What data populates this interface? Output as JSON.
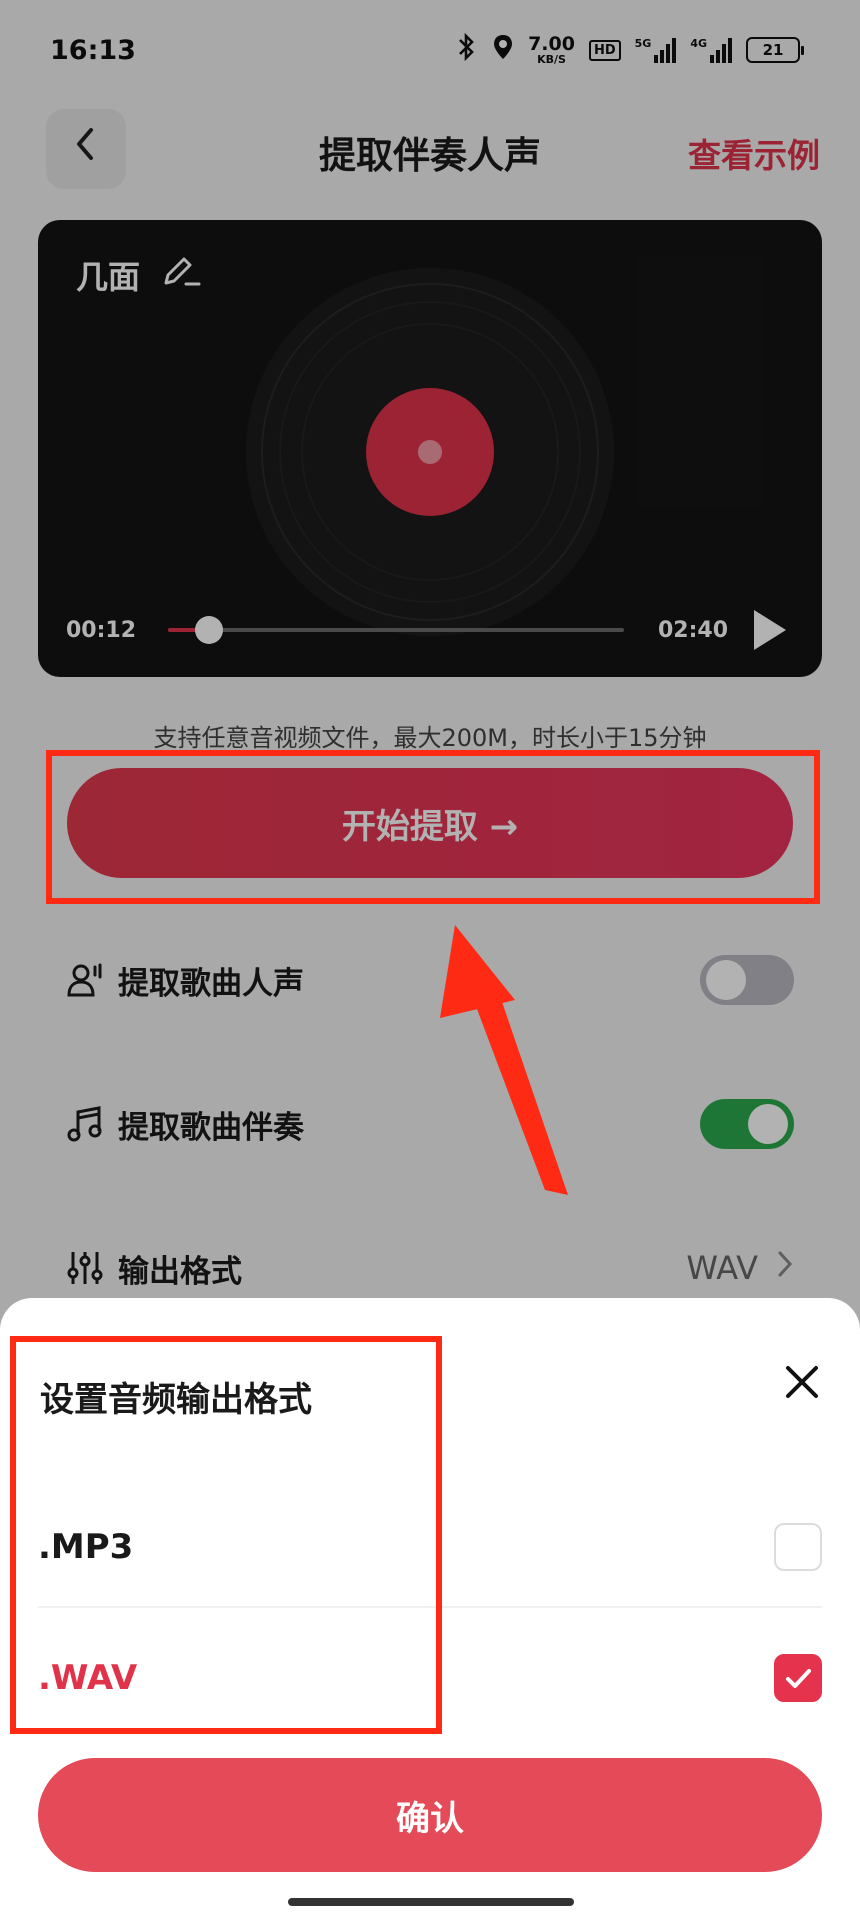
{
  "status_bar": {
    "time": "16:13",
    "net_speed": "7.00",
    "net_unit": "KB/S",
    "hd": "HD",
    "sig1": "5G",
    "sig2": "4G",
    "battery": "21"
  },
  "header": {
    "back_icon": "chevron-left-icon",
    "title": "提取伴奏人声",
    "example_link": "查看示例"
  },
  "player": {
    "track_name": "几面",
    "edit_icon": "pencil-icon",
    "current_time": "00:12",
    "total_time": "02:40",
    "progress": 0.09,
    "play_icon": "play-icon"
  },
  "hint": "支持任意音视频文件，最大200M，时长小于15分钟",
  "start_button": "开始提取 →",
  "options": {
    "vocal": {
      "label": "提取歌曲人声",
      "enabled": false,
      "icon": "user-voice-icon"
    },
    "accompaniment": {
      "label": "提取歌曲伴奏",
      "enabled": true,
      "icon": "music-note-icon"
    },
    "format": {
      "label": "输出格式",
      "value": "WAV",
      "icon": "sliders-icon"
    }
  },
  "sheet": {
    "title": "设置音频输出格式",
    "close_icon": "close-icon",
    "formats": [
      {
        "name": ".MP3",
        "selected": false
      },
      {
        "name": ".WAV",
        "selected": true
      }
    ],
    "confirm": "确认"
  },
  "colors": {
    "accent": "#e0334a",
    "toggle_on": "#2aa94c",
    "highlight": "#ff2a14"
  }
}
